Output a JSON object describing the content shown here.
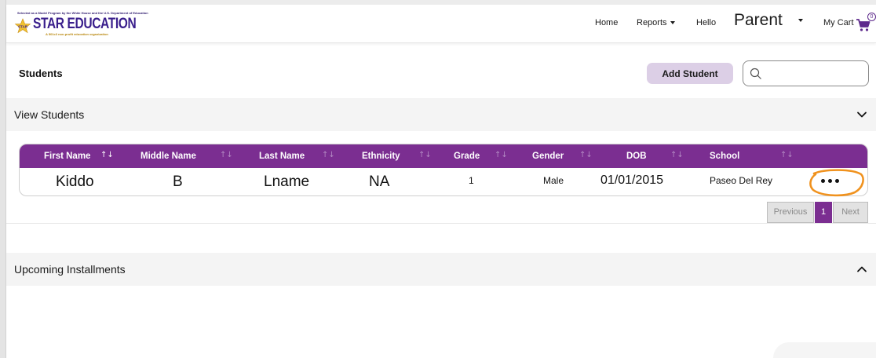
{
  "logo": {
    "tagline": "Selected as a Model Program by the White House and the U.S. Department of Education",
    "star_label": "STAR",
    "name": "STAR EDUCATION",
    "subtitle": "A 501c3 non-profit education organization"
  },
  "nav": {
    "home": "Home",
    "reports": "Reports",
    "hello": "Hello",
    "user": "Parent",
    "cart_label": "My Cart",
    "cart_count": "0"
  },
  "page": {
    "title": "Students",
    "add_button": "Add Student",
    "search_value": ""
  },
  "view_section": {
    "title": "View Students",
    "expanded": true
  },
  "table": {
    "headers": [
      "First Name",
      "Middle Name",
      "Last Name",
      "Ethnicity",
      "Grade",
      "Gender",
      "DOB",
      "School"
    ],
    "rows": [
      [
        "Kiddo",
        "B",
        "Lname",
        "NA",
        "1",
        "Male",
        "01/01/2015",
        "Paseo Del Rey"
      ]
    ]
  },
  "pagination": {
    "previous": "Previous",
    "current": "1",
    "next": "Next"
  },
  "installments_section": {
    "title": "Upcoming Installments",
    "expanded": false
  },
  "colors": {
    "table_header": "#7b2e91",
    "add_button_bg": "#dccfe6",
    "highlight_ring": "#f0921e",
    "logo_purple": "#3a1f8c"
  }
}
